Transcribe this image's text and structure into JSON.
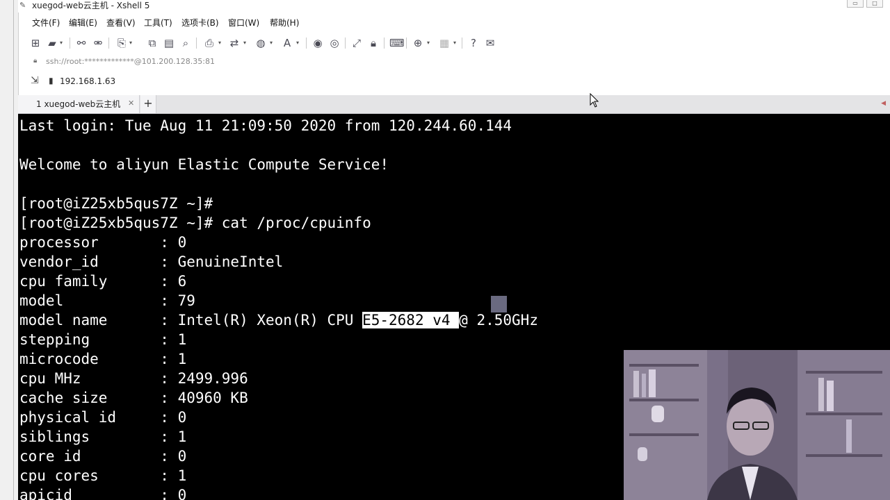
{
  "window": {
    "title": "xuegod-web云主机 - Xshell 5"
  },
  "menu": [
    "文件(F)",
    "编辑(E)",
    "查看(V)",
    "工具(T)",
    "选项卡(B)",
    "窗口(W)",
    "帮助(H)"
  ],
  "address": {
    "text": "ssh://root:*************@101.200.128.35:81"
  },
  "links": {
    "bookmark": "192.168.1.63"
  },
  "tabs": {
    "active_label": "1 xuegod-web云主机",
    "add": "+"
  },
  "terminal": {
    "lines": [
      "Last login: Tue Aug 11 21:09:50 2020 from 120.244.60.144",
      "",
      "Welcome to aliyun Elastic Compute Service!",
      "",
      "[root@iZ25xb5qus7Z ~]#",
      "[root@iZ25xb5qus7Z ~]# cat /proc/cpuinfo",
      "processor       : 0",
      "vendor_id       : GenuineIntel",
      "cpu family      : 6",
      "model           : 79",
      "",
      "stepping        : 1",
      "microcode       : 1",
      "cpu MHz         : 2499.996",
      "cache size      : 40960 KB",
      "physical id     : 0",
      "siblings        : 1",
      "core id         : 0",
      "cpu cores       : 1",
      "apicid          : 0"
    ],
    "model_name_prefix": "model name      : Intel(R) Xeon(R) CPU ",
    "model_name_highlight": "E5-2682 v4 ",
    "model_name_suffix": "@ 2.50GHz"
  },
  "colors": {
    "terminal_bg": "#000000",
    "terminal_fg": "#ffffff",
    "selection_bg": "#ffffff"
  }
}
